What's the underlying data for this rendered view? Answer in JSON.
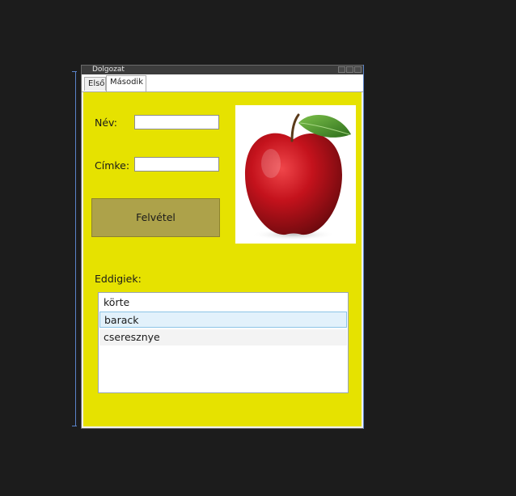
{
  "window": {
    "title": "Dolgozat"
  },
  "tabs": [
    {
      "label": "Első"
    },
    {
      "label": "Második"
    }
  ],
  "form": {
    "name_label": "Név:",
    "name_value": "",
    "tag_label": "Címke:",
    "tag_value": "",
    "submit_label": "Felvétel"
  },
  "list": {
    "label": "Eddigiek:",
    "items": [
      {
        "text": "körte",
        "state": "normal"
      },
      {
        "text": "barack",
        "state": "selected"
      },
      {
        "text": "cseresznye",
        "state": "hover"
      }
    ]
  },
  "image": {
    "subject": "red-apple",
    "colors": {
      "apple": "#c4121c",
      "leaf": "#3f8a26"
    }
  },
  "colors": {
    "panel_bg": "#e6e200",
    "button_bg": "#ada24a",
    "selection": "#e2f1fb"
  }
}
